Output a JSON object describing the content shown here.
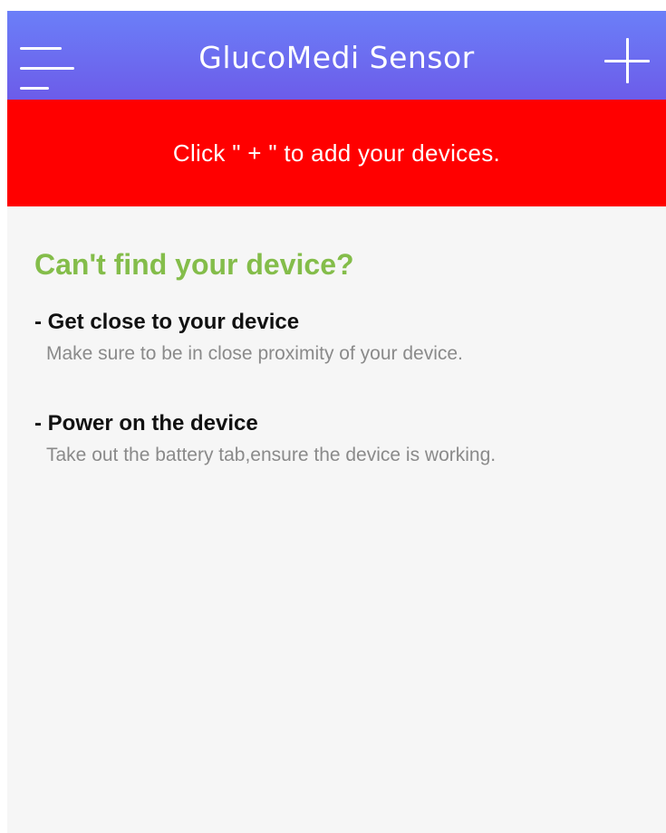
{
  "header": {
    "title": "GlucoMedi Sensor",
    "menu_icon": "hamburger-menu-icon",
    "add_icon": "plus-icon"
  },
  "banner": {
    "text": "Click \" + \" to add your devices.",
    "color": "#ff0000"
  },
  "help": {
    "title": "Can't find your device?",
    "title_color": "#84bd4a",
    "tips": [
      {
        "heading": "- Get close to your device",
        "description": "Make sure to be in close proximity of your device."
      },
      {
        "heading": "- Power on the device",
        "description": "Take out the battery tab,ensure the device is working."
      }
    ]
  },
  "colors": {
    "nav_gradient_top": "#6b7ff8",
    "nav_gradient_bottom": "#6c5ce9",
    "background": "#f6f6f6"
  }
}
